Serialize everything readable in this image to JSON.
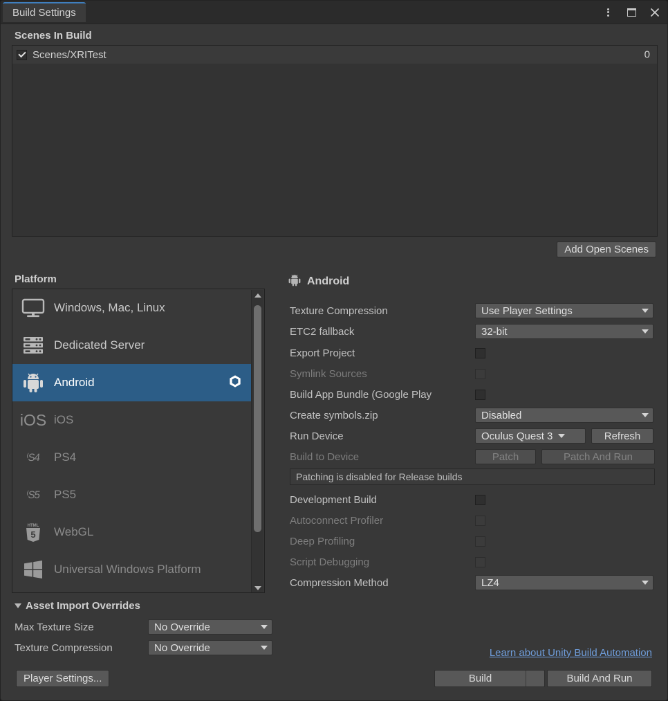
{
  "window": {
    "tab_title": "Build Settings",
    "accent_color": "#3f7fbf",
    "controls": {
      "menu": "kebab-menu",
      "maximize": "maximize",
      "close": "✕"
    }
  },
  "scenes": {
    "header": "Scenes In Build",
    "items": [
      {
        "name": "Scenes/XRITest",
        "checked": true,
        "index": "0"
      }
    ],
    "add_open_scenes": "Add Open Scenes"
  },
  "platform": {
    "header": "Platform",
    "items": [
      {
        "label": "Windows, Mac, Linux",
        "icon": "monitor-icon",
        "selected": false,
        "enabled": true
      },
      {
        "label": "Dedicated Server",
        "icon": "server-icon",
        "selected": false,
        "enabled": true
      },
      {
        "label": "Android",
        "icon": "android-icon",
        "selected": true,
        "enabled": true
      },
      {
        "label": "iOS",
        "icon": "ios-icon",
        "selected": false,
        "enabled": false
      },
      {
        "label": "PS4",
        "icon": "ps4-icon",
        "selected": false,
        "enabled": false
      },
      {
        "label": "PS5",
        "icon": "ps5-icon",
        "selected": false,
        "enabled": false
      },
      {
        "label": "WebGL",
        "icon": "html5-icon",
        "selected": false,
        "enabled": false
      },
      {
        "label": "Universal Windows Platform",
        "icon": "windows-icon",
        "selected": false,
        "enabled": false
      }
    ]
  },
  "settings": {
    "title": "Android",
    "title_icon": "android-icon",
    "texture_compression": {
      "label": "Texture Compression",
      "value": "Use Player Settings"
    },
    "etc2_fallback": {
      "label": "ETC2 fallback",
      "value": "32-bit"
    },
    "export_project": {
      "label": "Export Project",
      "checked": false,
      "enabled": true
    },
    "symlink_sources": {
      "label": "Symlink Sources",
      "checked": false,
      "enabled": false
    },
    "build_app_bundle": {
      "label": "Build App Bundle (Google Play",
      "checked": false,
      "enabled": true
    },
    "create_symbols_zip": {
      "label": "Create symbols.zip",
      "value": "Disabled"
    },
    "run_device": {
      "label": "Run Device",
      "value": "Oculus Quest 3",
      "refresh": "Refresh"
    },
    "build_to_device": {
      "label": "Build to Device",
      "patch": "Patch",
      "patch_and_run": "Patch And Run"
    },
    "helpbox": "Patching is disabled for Release builds",
    "development_build": {
      "label": "Development Build",
      "checked": false,
      "enabled": true
    },
    "autoconnect_profiler": {
      "label": "Autoconnect Profiler",
      "checked": false,
      "enabled": false
    },
    "deep_profiling": {
      "label": "Deep Profiling",
      "checked": false,
      "enabled": false
    },
    "script_debugging": {
      "label": "Script Debugging",
      "checked": false,
      "enabled": false
    },
    "compression_method": {
      "label": "Compression Method",
      "value": "LZ4"
    }
  },
  "asset_import_overrides": {
    "header": "Asset Import Overrides",
    "max_texture_size": {
      "label": "Max Texture Size",
      "value": "No Override"
    },
    "texture_compression": {
      "label": "Texture Compression",
      "value": "No Override"
    }
  },
  "footer": {
    "player_settings": "Player Settings...",
    "automation_link": "Learn about Unity Build Automation",
    "link_color": "#6f9ddb",
    "build": "Build",
    "build_and_run": "Build And Run"
  }
}
